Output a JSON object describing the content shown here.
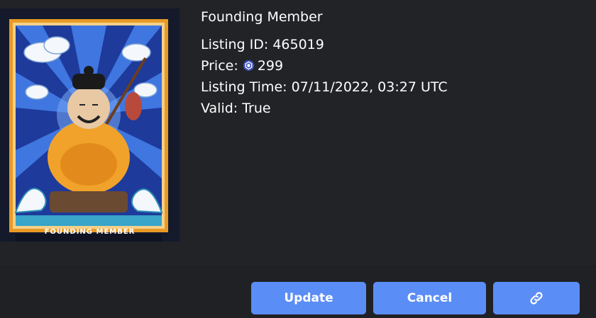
{
  "card": {
    "caption": "FOUNDING MEMBER",
    "colors": {
      "frame": "#e89a25",
      "sky": "#2f5fd6",
      "robe": "#f0a22a",
      "wave": "#2a8fb8"
    }
  },
  "listing": {
    "title": "Founding Member",
    "id_label": "Listing ID:",
    "id_value": "465019",
    "price_label": "Price:",
    "price_icon": "cronos-coin-icon",
    "price_value": "299",
    "time_label": "Listing Time:",
    "time_value": "07/11/2022, 03:27 UTC",
    "valid_label": "Valid:",
    "valid_value": "True"
  },
  "actions": {
    "update_label": "Update",
    "cancel_label": "Cancel",
    "link_icon": "link-icon",
    "accent": "#5b8df6"
  }
}
